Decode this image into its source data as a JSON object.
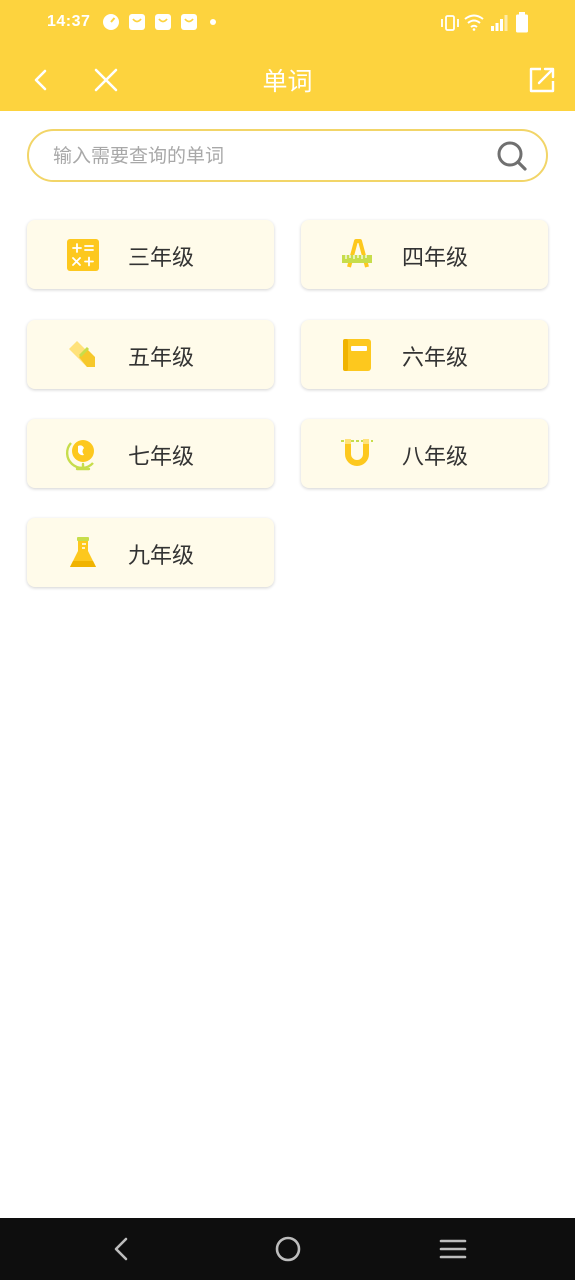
{
  "status_bar": {
    "time": "14:37"
  },
  "app_bar": {
    "title": "单词",
    "background_color": "#FDD33E"
  },
  "search": {
    "placeholder": "输入需要查询的单词",
    "value": ""
  },
  "grades": [
    {
      "label": "三年级",
      "icon": "calculator-icon"
    },
    {
      "label": "四年级",
      "icon": "ruler-letter-a-icon"
    },
    {
      "label": "五年级",
      "icon": "eraser-icon"
    },
    {
      "label": "六年级",
      "icon": "notebook-icon"
    },
    {
      "label": "七年级",
      "icon": "globe-icon"
    },
    {
      "label": "八年级",
      "icon": "magnet-icon"
    },
    {
      "label": "九年级",
      "icon": "flask-icon"
    }
  ],
  "colors": {
    "accent": "#FDD33E",
    "card_background": "#FFFBEA",
    "search_border": "#F2D568",
    "text": "#333333"
  }
}
